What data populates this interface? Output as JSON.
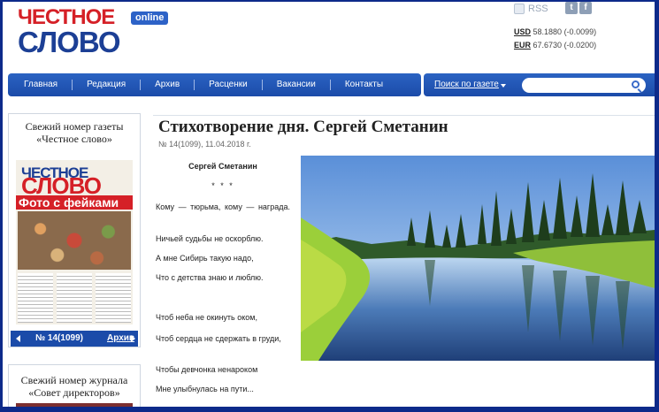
{
  "header": {
    "logo_line1": "ЧЕСТНОЕ",
    "logo_line2": "СЛОВО",
    "logo_badge": "online",
    "rss_label": "RSS",
    "social": [
      "twitter-icon",
      "facebook-icon"
    ],
    "rates": [
      {
        "code": "USD",
        "value": "58.1880 (-0.0099)"
      },
      {
        "code": "EUR",
        "value": "67.6730 (-0.0200)"
      }
    ]
  },
  "nav": {
    "items": [
      "Главная",
      "Редакция",
      "Архив",
      "Расценки",
      "Вакансии",
      "Контакты"
    ],
    "search_label": "Поиск по газете",
    "search_placeholder": ""
  },
  "sidebar": {
    "newspaper_title_line1": "Свежий номер газеты",
    "newspaper_title_line2": "«Честное слово»",
    "paper_name_top": "ЧЕСТНОЕ",
    "paper_name_bottom": "СЛОВО",
    "paper_headline": "Фото с фейками",
    "issue_label": "№ 14(1099)",
    "archive_link": "Архив",
    "journal_title_line1": "Свежий номер журнала",
    "journal_title_line2": "«Совет директоров»"
  },
  "article": {
    "title": "Стихотворение дня. Сергей Сметанин",
    "meta": "№ 14(1099), 11.04.2018 г.",
    "author": "Сергей Сметанин",
    "stars": "* * *",
    "lines": [
      "Кому — тюрьма, кому — награда.",
      "Ничьей судьбы не оскорблю.",
      "А мне Сибирь такую надо,",
      "Что с детства знаю и люблю.",
      "Чтоб неба не окинуть оком,",
      "Чтоб сердца не сдержать в груди,",
      "Чтобы девчонка ненароком",
      "Мне улыбнулась на пути..."
    ]
  },
  "colors": {
    "brand_red": "#d52027",
    "brand_blue": "#1c3f95",
    "nav_blue": "#1b4ba9"
  }
}
